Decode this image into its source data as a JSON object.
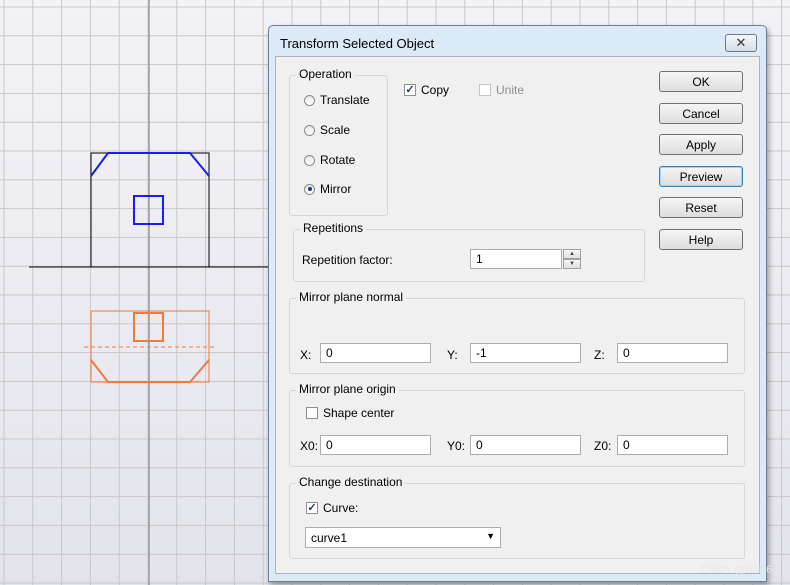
{
  "dialog": {
    "title": "Transform Selected Object"
  },
  "operation": {
    "legend": "Operation",
    "options": [
      {
        "label": "Translate",
        "selected": false
      },
      {
        "label": "Scale",
        "selected": false
      },
      {
        "label": "Rotate",
        "selected": false
      },
      {
        "label": "Mirror",
        "selected": true
      }
    ]
  },
  "copy": {
    "label": "Copy",
    "checked": true
  },
  "unite": {
    "label": "Unite",
    "checked": false,
    "enabled": false
  },
  "buttons": {
    "ok": "OK",
    "cancel": "Cancel",
    "apply": "Apply",
    "preview": "Preview",
    "reset": "Reset",
    "help": "Help"
  },
  "repetitions": {
    "legend": "Repetitions",
    "factor_label": "Repetition factor:",
    "factor_value": "1"
  },
  "mirror_normal": {
    "legend": "Mirror plane normal",
    "x_label": "X:",
    "x_value": "0",
    "y_label": "Y:",
    "y_value": "-1",
    "z_label": "Z:",
    "z_value": "0"
  },
  "mirror_origin": {
    "legend": "Mirror plane origin",
    "shape_center_label": "Shape center",
    "shape_center_checked": false,
    "x0_label": "X0:",
    "x0_value": "0",
    "y0_label": "Y0:",
    "y0_value": "0",
    "z0_label": "Z0:",
    "z0_value": "0"
  },
  "destination": {
    "legend": "Change destination",
    "curve_label": "Curve:",
    "curve_checked": true,
    "curve_selected": "curve1"
  },
  "watermark": "CSDN @Bill66",
  "colors": {
    "original_shape": "#1a1aff",
    "mirrored_shape": "#f07a3c",
    "outline": "#000000",
    "grid_line": "#c8c8c8",
    "background": "#ececf2"
  }
}
